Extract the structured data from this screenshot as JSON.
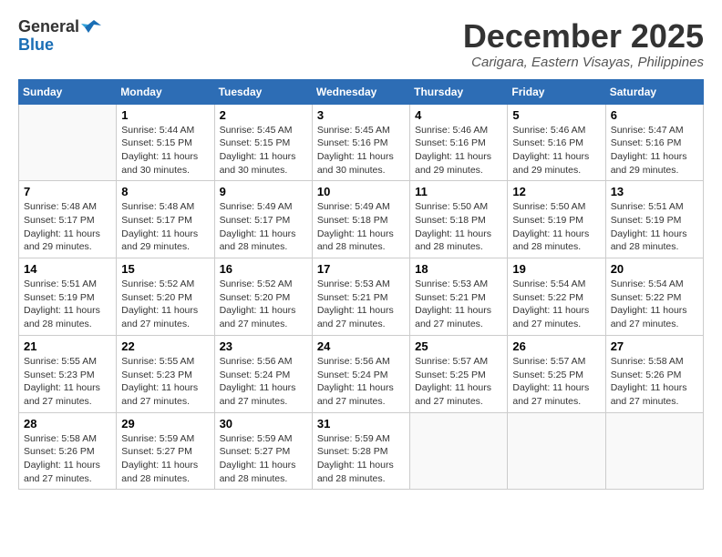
{
  "logo": {
    "general": "General",
    "blue": "Blue"
  },
  "title": "December 2025",
  "subtitle": "Carigara, Eastern Visayas, Philippines",
  "weekdays": [
    "Sunday",
    "Monday",
    "Tuesday",
    "Wednesday",
    "Thursday",
    "Friday",
    "Saturday"
  ],
  "weeks": [
    [
      {
        "day": "",
        "info": ""
      },
      {
        "day": "1",
        "info": "Sunrise: 5:44 AM\nSunset: 5:15 PM\nDaylight: 11 hours\nand 30 minutes."
      },
      {
        "day": "2",
        "info": "Sunrise: 5:45 AM\nSunset: 5:15 PM\nDaylight: 11 hours\nand 30 minutes."
      },
      {
        "day": "3",
        "info": "Sunrise: 5:45 AM\nSunset: 5:16 PM\nDaylight: 11 hours\nand 30 minutes."
      },
      {
        "day": "4",
        "info": "Sunrise: 5:46 AM\nSunset: 5:16 PM\nDaylight: 11 hours\nand 29 minutes."
      },
      {
        "day": "5",
        "info": "Sunrise: 5:46 AM\nSunset: 5:16 PM\nDaylight: 11 hours\nand 29 minutes."
      },
      {
        "day": "6",
        "info": "Sunrise: 5:47 AM\nSunset: 5:16 PM\nDaylight: 11 hours\nand 29 minutes."
      }
    ],
    [
      {
        "day": "7",
        "info": "Sunrise: 5:48 AM\nSunset: 5:17 PM\nDaylight: 11 hours\nand 29 minutes."
      },
      {
        "day": "8",
        "info": "Sunrise: 5:48 AM\nSunset: 5:17 PM\nDaylight: 11 hours\nand 29 minutes."
      },
      {
        "day": "9",
        "info": "Sunrise: 5:49 AM\nSunset: 5:17 PM\nDaylight: 11 hours\nand 28 minutes."
      },
      {
        "day": "10",
        "info": "Sunrise: 5:49 AM\nSunset: 5:18 PM\nDaylight: 11 hours\nand 28 minutes."
      },
      {
        "day": "11",
        "info": "Sunrise: 5:50 AM\nSunset: 5:18 PM\nDaylight: 11 hours\nand 28 minutes."
      },
      {
        "day": "12",
        "info": "Sunrise: 5:50 AM\nSunset: 5:19 PM\nDaylight: 11 hours\nand 28 minutes."
      },
      {
        "day": "13",
        "info": "Sunrise: 5:51 AM\nSunset: 5:19 PM\nDaylight: 11 hours\nand 28 minutes."
      }
    ],
    [
      {
        "day": "14",
        "info": "Sunrise: 5:51 AM\nSunset: 5:19 PM\nDaylight: 11 hours\nand 28 minutes."
      },
      {
        "day": "15",
        "info": "Sunrise: 5:52 AM\nSunset: 5:20 PM\nDaylight: 11 hours\nand 27 minutes."
      },
      {
        "day": "16",
        "info": "Sunrise: 5:52 AM\nSunset: 5:20 PM\nDaylight: 11 hours\nand 27 minutes."
      },
      {
        "day": "17",
        "info": "Sunrise: 5:53 AM\nSunset: 5:21 PM\nDaylight: 11 hours\nand 27 minutes."
      },
      {
        "day": "18",
        "info": "Sunrise: 5:53 AM\nSunset: 5:21 PM\nDaylight: 11 hours\nand 27 minutes."
      },
      {
        "day": "19",
        "info": "Sunrise: 5:54 AM\nSunset: 5:22 PM\nDaylight: 11 hours\nand 27 minutes."
      },
      {
        "day": "20",
        "info": "Sunrise: 5:54 AM\nSunset: 5:22 PM\nDaylight: 11 hours\nand 27 minutes."
      }
    ],
    [
      {
        "day": "21",
        "info": "Sunrise: 5:55 AM\nSunset: 5:23 PM\nDaylight: 11 hours\nand 27 minutes."
      },
      {
        "day": "22",
        "info": "Sunrise: 5:55 AM\nSunset: 5:23 PM\nDaylight: 11 hours\nand 27 minutes."
      },
      {
        "day": "23",
        "info": "Sunrise: 5:56 AM\nSunset: 5:24 PM\nDaylight: 11 hours\nand 27 minutes."
      },
      {
        "day": "24",
        "info": "Sunrise: 5:56 AM\nSunset: 5:24 PM\nDaylight: 11 hours\nand 27 minutes."
      },
      {
        "day": "25",
        "info": "Sunrise: 5:57 AM\nSunset: 5:25 PM\nDaylight: 11 hours\nand 27 minutes."
      },
      {
        "day": "26",
        "info": "Sunrise: 5:57 AM\nSunset: 5:25 PM\nDaylight: 11 hours\nand 27 minutes."
      },
      {
        "day": "27",
        "info": "Sunrise: 5:58 AM\nSunset: 5:26 PM\nDaylight: 11 hours\nand 27 minutes."
      }
    ],
    [
      {
        "day": "28",
        "info": "Sunrise: 5:58 AM\nSunset: 5:26 PM\nDaylight: 11 hours\nand 27 minutes."
      },
      {
        "day": "29",
        "info": "Sunrise: 5:59 AM\nSunset: 5:27 PM\nDaylight: 11 hours\nand 28 minutes."
      },
      {
        "day": "30",
        "info": "Sunrise: 5:59 AM\nSunset: 5:27 PM\nDaylight: 11 hours\nand 28 minutes."
      },
      {
        "day": "31",
        "info": "Sunrise: 5:59 AM\nSunset: 5:28 PM\nDaylight: 11 hours\nand 28 minutes."
      },
      {
        "day": "",
        "info": ""
      },
      {
        "day": "",
        "info": ""
      },
      {
        "day": "",
        "info": ""
      }
    ]
  ]
}
